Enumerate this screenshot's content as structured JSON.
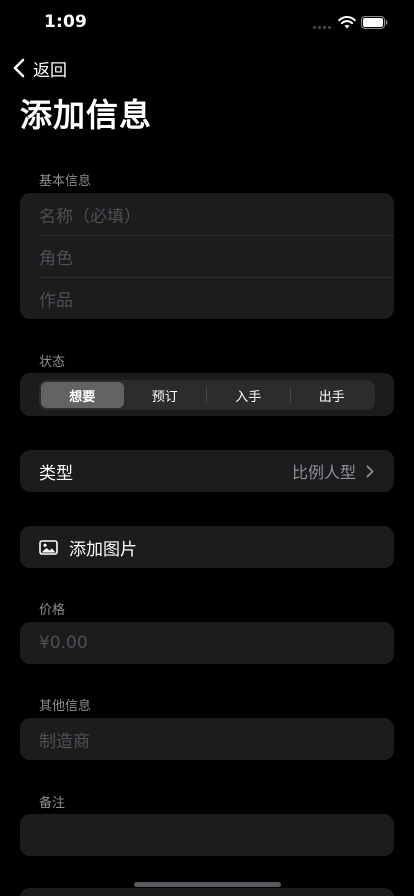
{
  "status_bar": {
    "time": "1:09"
  },
  "nav": {
    "back_label": "返回",
    "title": "添加信息"
  },
  "basic_info": {
    "header": "基本信息",
    "name_placeholder": "名称（必填）",
    "role_placeholder": "角色",
    "work_placeholder": "作品"
  },
  "status": {
    "header": "状态",
    "segments": [
      "想要",
      "预订",
      "入手",
      "出手"
    ],
    "selected": "想要"
  },
  "type": {
    "label": "类型",
    "value": "比例人型"
  },
  "add_photo": {
    "label": "添加图片"
  },
  "price": {
    "header": "价格",
    "placeholder": "¥0.00"
  },
  "other_info": {
    "header": "其他信息",
    "manufacturer_placeholder": "制造商"
  },
  "notes": {
    "header": "备注",
    "placeholder": ""
  }
}
